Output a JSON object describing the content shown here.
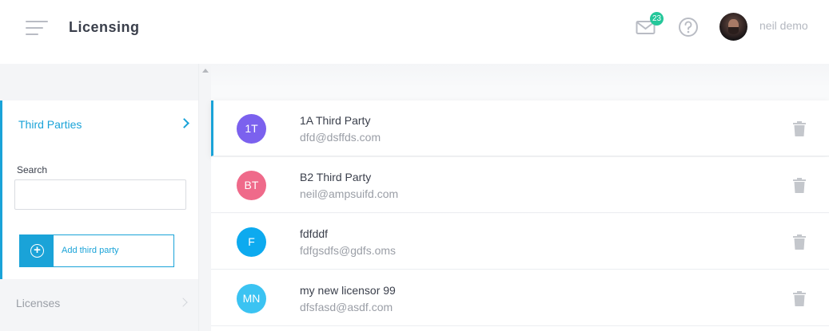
{
  "header": {
    "title": "Licensing",
    "mail_badge": "23",
    "user_name": "neil demo"
  },
  "sidebar": {
    "panel_title": "Third Parties",
    "search_label": "Search",
    "search_value": "",
    "add_button_label": "Add third party",
    "licenses_label": "Licenses"
  },
  "third_parties": [
    {
      "initials": "1T",
      "name": "1A Third Party",
      "email": "dfd@dsffds.com",
      "color": "#7b61ee"
    },
    {
      "initials": "BT",
      "name": "B2 Third Party",
      "email": "neil@ampsuifd.com",
      "color": "#ef6a8a"
    },
    {
      "initials": "F",
      "name": "fdfddf",
      "email": "fdfgsdfs@gdfs.oms",
      "color": "#0daaef"
    },
    {
      "initials": "MN",
      "name": "my new licensor 99",
      "email": "dfsfasd@asdf.com",
      "color": "#3bc3f2"
    }
  ],
  "colors": {
    "accent": "#1aa3d8",
    "badge": "#25c79a"
  }
}
